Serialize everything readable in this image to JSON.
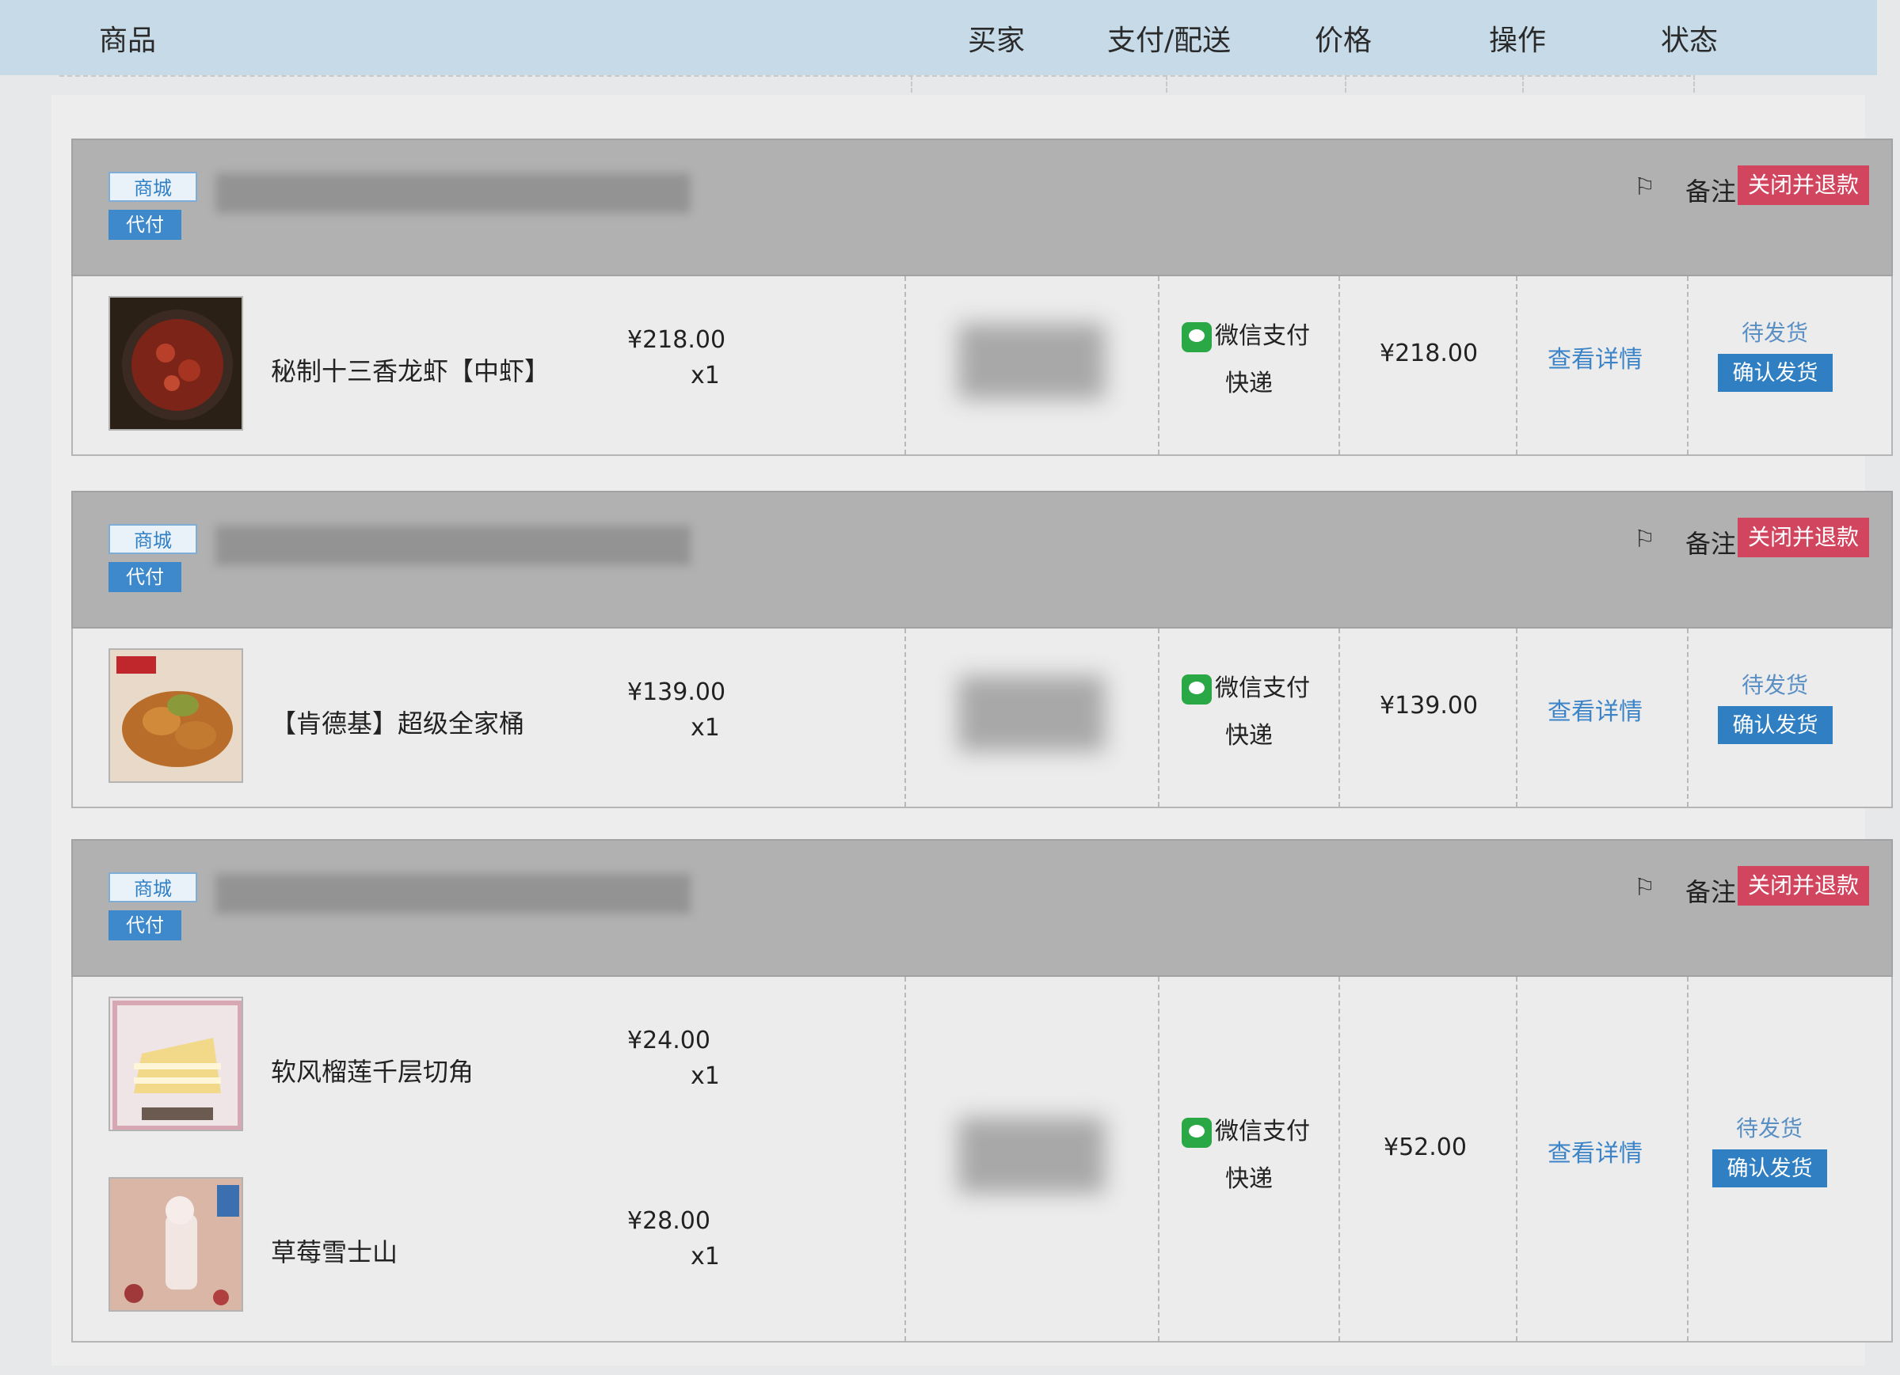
{
  "header": {
    "columns": [
      "商品",
      "买家",
      "支付/配送",
      "价格",
      "操作",
      "状态"
    ]
  },
  "orders": [
    {
      "tags": {
        "shop": "商城",
        "agent": "代付"
      },
      "remark_label": "备注",
      "close_label": "关闭并退款",
      "items": [
        {
          "name": "秘制十三香龙虾【中虾】",
          "unit_price": "¥218.00",
          "qty": "x1"
        }
      ],
      "payment": "微信支付",
      "shipping": "快递",
      "total": "¥218.00",
      "detail_label": "查看详情",
      "status": "待发货",
      "confirm_label": "确认发货"
    },
    {
      "tags": {
        "shop": "商城",
        "agent": "代付"
      },
      "remark_label": "备注",
      "close_label": "关闭并退款",
      "items": [
        {
          "name": "【肯德基】超级全家桶",
          "unit_price": "¥139.00",
          "qty": "x1"
        }
      ],
      "payment": "微信支付",
      "shipping": "快递",
      "total": "¥139.00",
      "detail_label": "查看详情",
      "status": "待发货",
      "confirm_label": "确认发货"
    },
    {
      "tags": {
        "shop": "商城",
        "agent": "代付"
      },
      "remark_label": "备注",
      "close_label": "关闭并退款",
      "items": [
        {
          "name": "软风榴莲千层切角",
          "unit_price": "¥24.00",
          "qty": "x1"
        },
        {
          "name": "草莓雪士山",
          "unit_price": "¥28.00",
          "qty": "x1"
        }
      ],
      "payment": "微信支付",
      "shipping": "快递",
      "total": "¥52.00",
      "detail_label": "查看详情",
      "status": "待发货",
      "confirm_label": "确认发货"
    }
  ],
  "colors": {
    "header_bg": "#c6dae8",
    "close_button": "#d2455f",
    "confirm_button": "#2f7fc2",
    "link": "#3c84c7",
    "wechat_green": "#2aa845"
  },
  "icons": [
    "flag-icon",
    "wechat-pay-icon"
  ]
}
